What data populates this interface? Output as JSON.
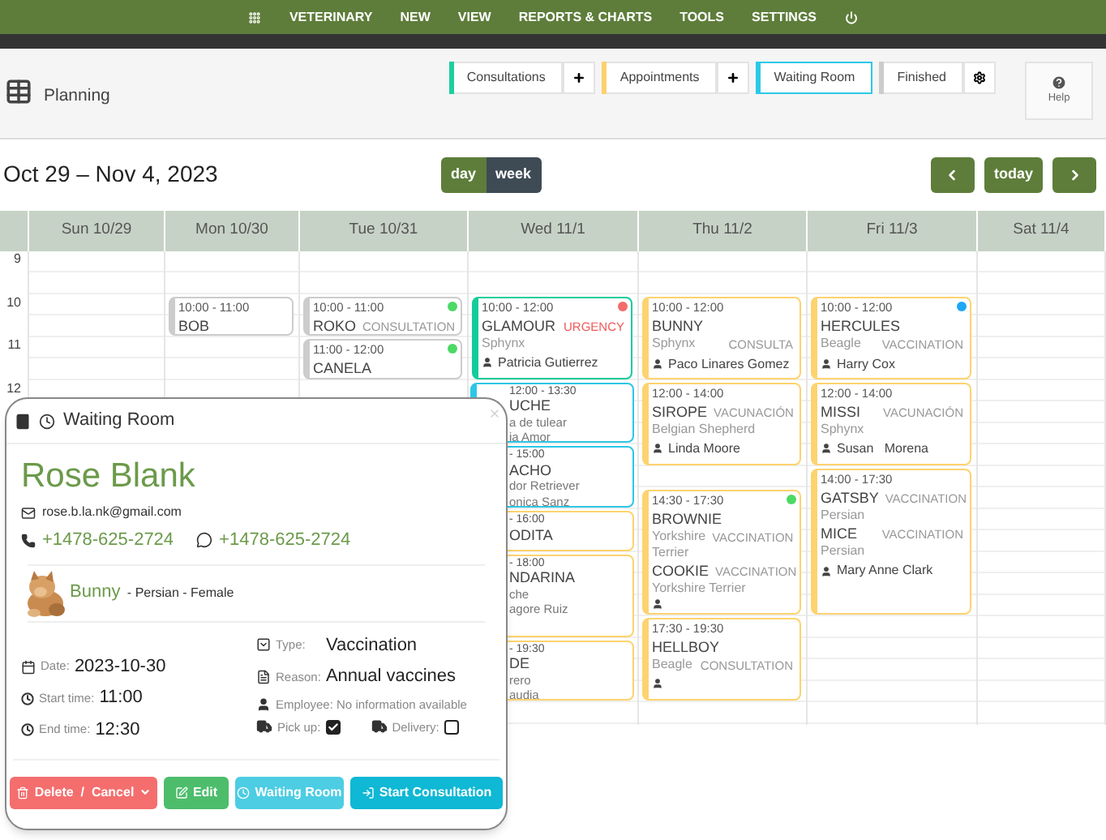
{
  "menu": [
    "VETERINARY",
    "NEW",
    "VIEW",
    "REPORTS & CHARTS",
    "TOOLS",
    "SETTINGS"
  ],
  "page_title": "Planning",
  "filters": [
    {
      "label": "Consultations",
      "color": "#1ccfa0",
      "add": true,
      "selected": false
    },
    {
      "label": "Appointments",
      "color": "#fcd06e",
      "add": true,
      "selected": false
    },
    {
      "label": "Waiting Room",
      "color": "#2dc8e8",
      "add": false,
      "selected": true
    },
    {
      "label": "Finished",
      "color": "#cccccc",
      "add": false,
      "selected": false
    }
  ],
  "help": "Help",
  "date_range": "Oct 29 – Nov 4, 2023",
  "views": [
    {
      "label": "day",
      "selected": false
    },
    {
      "label": "week",
      "selected": true
    }
  ],
  "today": "today",
  "days": [
    {
      "label": "Sun 10/29"
    },
    {
      "label": "Mon 10/30",
      "events": [
        {
          "kind": "full",
          "color": "#cccccc",
          "time": "10:00 - 11:00",
          "pets": [
            {
              "name": "BOB"
            }
          ]
        }
      ]
    },
    {
      "label": "Tue 10/31",
      "events": [
        {
          "kind": "full",
          "color": "#cccccc",
          "dot": {
            "color": "#4cd964"
          },
          "time": "10:00 - 11:00",
          "pets": [
            {
              "name": "ROKO",
              "tag": "CONSULTATION",
              "urgent": false
            }
          ]
        },
        {
          "kind": "full",
          "color": "#cccccc",
          "dot": {
            "color": "#4cd964"
          },
          "time": "11:00 - 12:00",
          "pets": [
            {
              "name": "CANELA"
            }
          ]
        }
      ]
    },
    {
      "label": "Wed 11/1",
      "events": [
        {
          "kind": "full",
          "color": "#12cc9a",
          "dot": {
            "color": "#f56b6b"
          },
          "time": "10:00 - 12:00",
          "pets": [
            {
              "name": "GLAMOUR",
              "tag": "URGENCY",
              "urgent": true,
              "breed": "Sphynx"
            }
          ],
          "owner": "Patricia Gutierrez"
        },
        {
          "kind": "partial",
          "color": "#2ec6e6",
          "lines": [
            "12:00 - 13:30",
            "UCHE",
            "a de tulear",
            "ia Amor"
          ]
        },
        {
          "kind": "partial",
          "color": "#2ec6e6",
          "lines": [
            "- 15:00",
            "ACHO",
            "dor Retriever",
            "onica Sanz"
          ]
        },
        {
          "kind": "partial",
          "color": "#fdd36f",
          "lines": [
            "- 16:00",
            "ODITA"
          ]
        },
        {
          "kind": "partial",
          "color": "#fdd36f",
          "lines": [
            "- 18:00",
            "NDARINA",
            "che",
            "agore Ruiz"
          ]
        },
        {
          "kind": "partial",
          "color": "#fdd36f",
          "lines": [
            "- 19:30",
            "DE",
            "rero",
            "audia"
          ]
        }
      ]
    },
    {
      "label": "Thu 11/2",
      "events": [
        {
          "kind": "full",
          "color": "#fdd36f",
          "time": "10:00 - 12:00",
          "pets": [
            {
              "name": "BUNNY",
              "breed": "Sphynx",
              "breed_tag": "CONSULTA",
              "urgent": false
            }
          ],
          "owner": "Paco Linares Gomez"
        },
        {
          "kind": "full",
          "color": "#fdd36f",
          "time": "12:00 - 14:00",
          "pets": [
            {
              "name": "SIROPE",
              "tag": "VACUNACIÓN",
              "urgent": false,
              "breed": "Belgian Shepherd"
            }
          ],
          "owner": "Linda Moore"
        },
        {
          "kind": "full",
          "color": "#fdd36f",
          "dot": {
            "color": "#4cd964"
          },
          "time": "14:30 - 17:30",
          "pets": [
            {
              "name": "BROWNIE",
              "breed": "Yorkshire Terrier",
              "breed_tag": "VACCINATION",
              "urgent": false
            },
            {
              "name": "COOKIE",
              "tag": "VACCINATION",
              "urgent": false,
              "breed": "Yorkshire Terrier"
            }
          ],
          "owner_icon": true
        },
        {
          "kind": "full",
          "color": "#fdd36f",
          "time": "17:30 - 19:30",
          "pets": [
            {
              "name": "HELLBOY",
              "breed": "Beagle",
              "breed_tag": "CONSULTATION",
              "urgent": false
            }
          ],
          "owner_icon": true
        }
      ]
    },
    {
      "label": "Fri 11/3",
      "events": [
        {
          "kind": "full",
          "color": "#fdd36f",
          "dot": {
            "color": "#1ea7f5"
          },
          "time": "10:00 - 12:00",
          "pets": [
            {
              "name": "HERCULES",
              "breed": "Beagle",
              "breed_tag": "VACCINATION",
              "urgent": false
            }
          ],
          "owner": "Harry Cox"
        },
        {
          "kind": "full",
          "color": "#fdd36f",
          "time": "12:00 - 14:00",
          "pets": [
            {
              "name": "MISSI",
              "tag": "VACUNACIÓN",
              "urgent": false,
              "breed": "Sphynx"
            }
          ],
          "owner": "Susan   Morena"
        },
        {
          "kind": "full",
          "color": "#fdd36f",
          "time": "14:00 - 17:30",
          "pets": [
            {
              "name": "GATSBY",
              "tag": "VACCINATION",
              "urgent": false,
              "breed": "Persian"
            },
            {
              "name": "MICE",
              "tag": "VACCINATION",
              "urgent": false,
              "breed": "Persian"
            }
          ],
          "owner": "Mary Anne Clark"
        }
      ]
    },
    {
      "label": "Sat 11/4"
    }
  ],
  "hours": [
    "9",
    "10",
    "11",
    "12"
  ],
  "popup": {
    "title": "Waiting Room",
    "client": "Rose Blank",
    "email": "rose.b.la.nk@gmail.com",
    "phone": "+1478-625-2724",
    "whatsapp": "+1478-625-2724",
    "pet": {
      "name": "Bunny",
      "details": " - Persian - Female"
    },
    "left": [
      {
        "kind": "date",
        "label": "Date:",
        "value": "2023-10-30"
      },
      {
        "kind": "time",
        "label": "Start time:",
        "value": "11:00"
      },
      {
        "kind": "time",
        "label": "End time:",
        "value": "12:30"
      }
    ],
    "type": {
      "label": "Type:",
      "value": "Vaccination"
    },
    "reason": {
      "label": "Reason:",
      "value": "Annual vaccines"
    },
    "employee": "Employee: No information available",
    "pickup": {
      "label": "Pick up:",
      "checked": true
    },
    "delivery": {
      "label": "Delivery:",
      "checked": false
    },
    "buttons": [
      {
        "kind": "delete",
        "label": "Delete  /  Cancel"
      },
      {
        "kind": "edit",
        "label": "Edit"
      },
      {
        "kind": "waiting",
        "label": "Waiting Room"
      },
      {
        "kind": "start",
        "label": "Start Consultation"
      }
    ]
  }
}
